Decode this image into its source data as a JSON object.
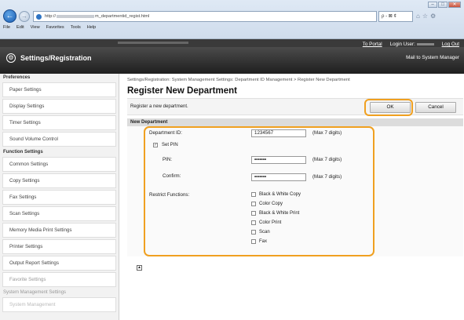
{
  "browser": {
    "url_prefix": "http://",
    "url_suffix": "m_departmentid_regist.html",
    "search_suffix": "ρ - ⊠ ¢",
    "window_min": "–",
    "window_max": "□",
    "window_close": "✕",
    "menu": [
      "File",
      "Edit",
      "View",
      "Favorites",
      "Tools",
      "Help"
    ]
  },
  "header": {
    "app_title": "Settings/Registration",
    "to_portal": "To Portal",
    "login_user_label": "Login User:",
    "logout": "Log Out",
    "mail_link": "Mail to System Manager"
  },
  "sidebar": {
    "preferences_head": "Preferences",
    "preferences_items": [
      "Paper Settings",
      "Display Settings",
      "Timer Settings",
      "Sound Volume Control"
    ],
    "function_head": "Function Settings",
    "function_items": [
      "Common Settings",
      "Copy Settings",
      "Fax Settings",
      "Scan Settings",
      "Memory Media Print Settings",
      "Printer Settings",
      "Output Report Settings",
      "Favorite Settings"
    ],
    "system_head": "System Management Settings",
    "system_items": [
      "System Management"
    ]
  },
  "main": {
    "breadcrumb": "Settings/Registration: System Management Settings: Department ID Management > Register New Department",
    "title": "Register New Department",
    "description": "Register a new department.",
    "ok_label": "OK",
    "cancel_label": "Cancel",
    "section_title": "New Department",
    "department_id_label": "Department ID:",
    "department_id_value": "1234567",
    "department_id_hint": "(Max 7 digits)",
    "set_pin_label": "Set PIN",
    "set_pin_checked": true,
    "pin_label": "PIN:",
    "pin_value": "•••••••",
    "pin_hint": "(Max 7 digits)",
    "confirm_label": "Confirm:",
    "confirm_value": "•••••••",
    "confirm_hint": "(Max 7 digits)",
    "restrict_label": "Restrict Functions:",
    "restrict_options": [
      "Black & White Copy",
      "Color Copy",
      "Black & White Print",
      "Color Print",
      "Scan",
      "Fax"
    ]
  },
  "colors": {
    "highlight": "#f0a020",
    "header_dark": "#2a2a2a"
  }
}
